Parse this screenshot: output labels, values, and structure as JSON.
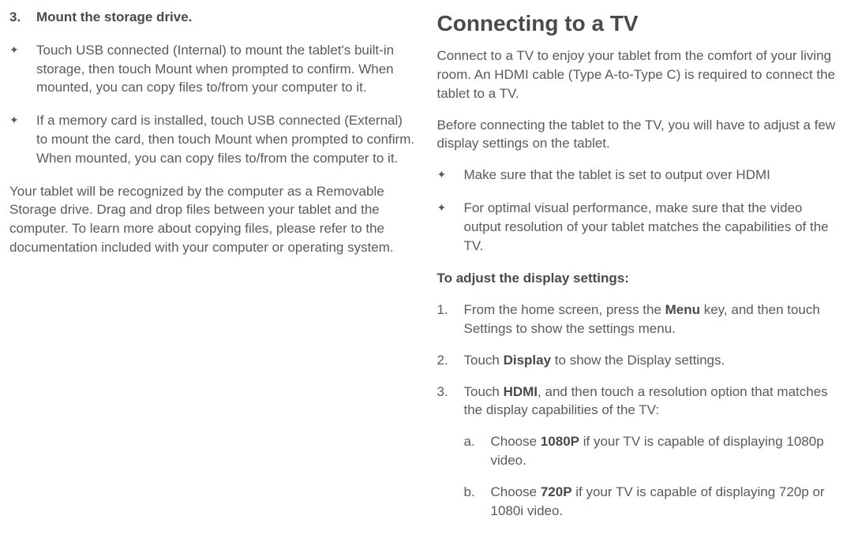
{
  "left": {
    "heading_num": "3.",
    "heading_text": "Mount the storage drive.",
    "bullet1": "Touch USB connected (Internal) to mount the tablet's built-in storage, then touch Mount when prompted to confirm. When mounted, you can copy files to/from your computer to it.",
    "bullet2": "If a memory card is installed, touch USB connected (External) to mount the card, then touch Mount when prompted to confirm. When mounted, you can copy files to/from the computer to it.",
    "para": "Your tablet will be recognized by the computer as a Removable Storage drive. Drag and drop files between your tablet and the computer. To learn more about copying files, please refer to the documentation included with your computer or operating system."
  },
  "right": {
    "title": "Connecting to a TV",
    "intro1": "Connect to a TV to enjoy your tablet from the comfort of your living room. An HDMI cable (Type A-to-Type C) is required to connect the tablet to a TV.",
    "intro2": "Before connecting the tablet to the TV, you will have to adjust a few display settings on the tablet.",
    "bullet1": "Make sure that the tablet is set to output over HDMI",
    "bullet2": "For optimal visual performance, make sure that the video output resolution of your tablet matches the capabilities of the TV.",
    "subhead": "To adjust the display settings:",
    "step1_pre": "From the home screen, press the ",
    "step1_bold": "Menu",
    "step1_post": " key, and then touch Settings to show the settings menu.",
    "step2_pre": "Touch ",
    "step2_bold": "Display",
    "step2_post": " to show the Display settings.",
    "step3_pre": "Touch ",
    "step3_bold": "HDMI",
    "step3_post": ", and then touch a resolution option that matches the display capabilities of the TV:",
    "step3a_pre": "Choose ",
    "step3a_bold": "1080P",
    "step3a_post": " if your TV is capable of displaying 1080p video.",
    "step3b_pre": "Choose ",
    "step3b_bold": "720P",
    "step3b_post": " if your TV is capable of displaying 720p or 1080i video."
  },
  "star": "✦"
}
